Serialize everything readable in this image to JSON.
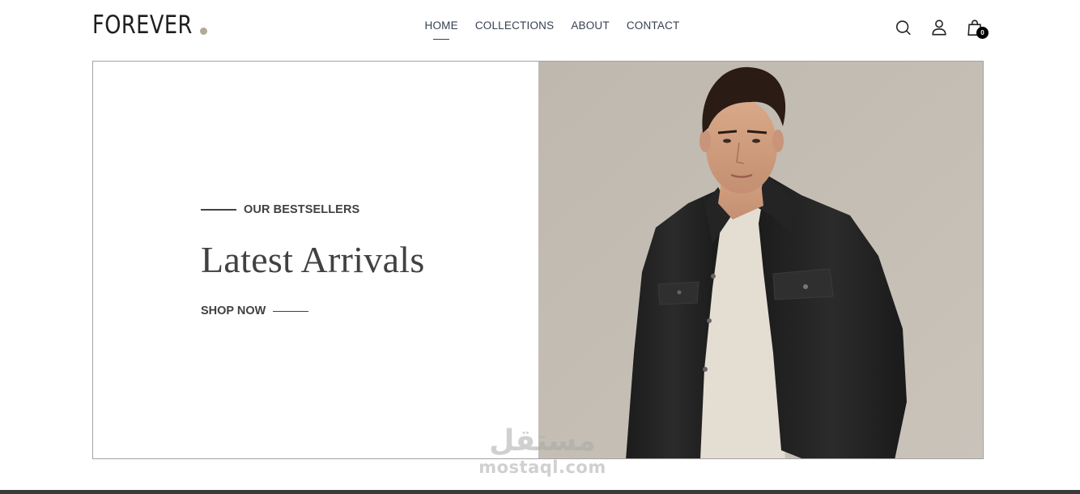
{
  "brand": {
    "name": "FOREVER",
    "dot_color": "#b3a99b"
  },
  "nav": {
    "items": [
      {
        "label": "HOME",
        "active": true
      },
      {
        "label": "COLLECTIONS",
        "active": false
      },
      {
        "label": "ABOUT",
        "active": false
      },
      {
        "label": "CONTACT",
        "active": false
      }
    ]
  },
  "header_icons": {
    "search": "search-icon",
    "profile": "user-icon",
    "cart": "shopping-bag-icon",
    "cart_count": "0"
  },
  "hero": {
    "eyebrow": "OUR BESTSELLERS",
    "title": "Latest Arrivals",
    "cta": "SHOP NOW",
    "image": "man-in-black-denim-jacket-photo",
    "image_bg_color": "#c5bfb5"
  },
  "watermark": {
    "arabic": "مستقل",
    "latin": "mostaql.com"
  },
  "colors": {
    "text": "#414141",
    "nav_text": "#374151",
    "border": "#a3a3a3"
  }
}
